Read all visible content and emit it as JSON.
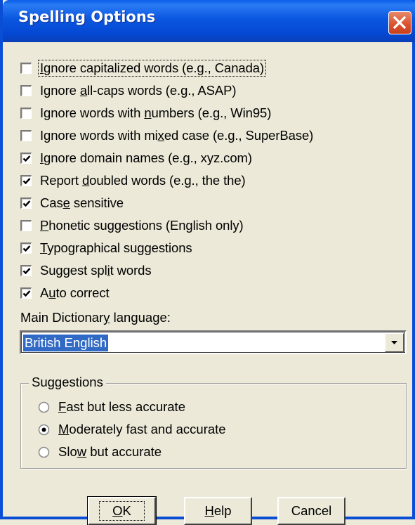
{
  "window": {
    "title": "Spelling Options"
  },
  "options": [
    {
      "pre": "",
      "key": "I",
      "post": "gnore capitalized words (e.g., Canada)",
      "checked": false,
      "focused": true
    },
    {
      "pre": "Ignore ",
      "key": "a",
      "post": "ll-caps words (e.g., ASAP)",
      "checked": false
    },
    {
      "pre": "Ignore words with ",
      "key": "n",
      "post": "umbers (e.g., Win95)",
      "checked": false
    },
    {
      "pre": "Ignore words with mi",
      "key": "x",
      "post": "ed case (e.g., SuperBase)",
      "checked": false
    },
    {
      "pre": "",
      "key": "I",
      "post": "gnore domain names (e.g., xyz.com)",
      "checked": true
    },
    {
      "pre": "Report ",
      "key": "d",
      "post": "oubled words (e.g., the the)",
      "checked": true
    },
    {
      "pre": "Cas",
      "key": "e",
      "post": " sensitive",
      "checked": true
    },
    {
      "pre": "",
      "key": "P",
      "post": "honetic suggestions (English only)",
      "checked": false
    },
    {
      "pre": "",
      "key": "T",
      "post": "ypographical suggestions",
      "checked": true
    },
    {
      "pre": "Suggest spl",
      "key": "i",
      "post": "t words",
      "checked": true
    },
    {
      "pre": "A",
      "key": "u",
      "post": "to correct",
      "checked": true
    }
  ],
  "dictionary": {
    "label_pre": "Main Dictionar",
    "label_key": "y",
    "label_post": " language:",
    "value": "British English"
  },
  "suggestions": {
    "title": "Suggestions",
    "options": [
      {
        "pre": "",
        "key": "F",
        "post": "ast but less accurate",
        "selected": false
      },
      {
        "pre": "",
        "key": "M",
        "post": "oderately fast and accurate",
        "selected": true
      },
      {
        "pre": "Slo",
        "key": "w",
        "post": " but accurate",
        "selected": false
      }
    ]
  },
  "buttons": {
    "ok": {
      "key": "O",
      "post": "K"
    },
    "help": {
      "key": "H",
      "post": "elp"
    },
    "cancel": {
      "label": "Cancel"
    }
  },
  "colors": {
    "titlebar": "#0a5eea",
    "selection": "#316ac5",
    "dialog_bg": "#ece9d8"
  }
}
